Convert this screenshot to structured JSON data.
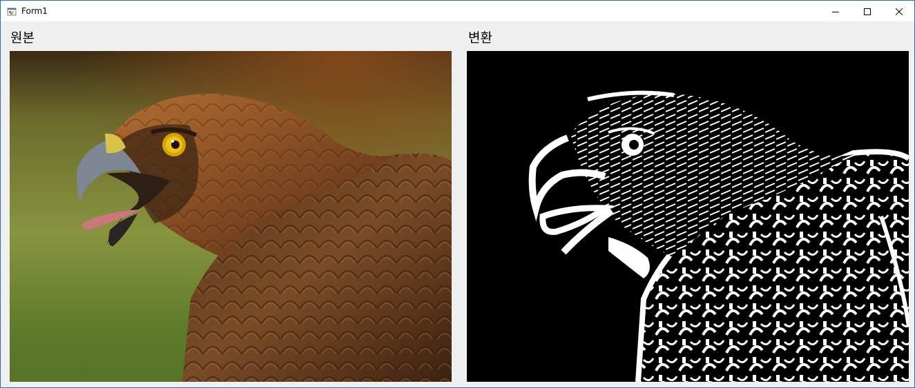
{
  "window": {
    "title": "Form1",
    "icon": "winforms-app-icon",
    "controls": {
      "minimize_icon": "minimize-icon",
      "maximize_icon": "maximize-icon",
      "close_icon": "close-icon"
    }
  },
  "panels": {
    "original": {
      "label": "원본",
      "image": "eagle-photo-original"
    },
    "converted": {
      "label": "변환",
      "image": "eagle-photo-binarized"
    }
  },
  "colors": {
    "window_border": "#2b6cb0",
    "client_background": "#f0f0f0",
    "titlebar_background": "#ffffff"
  }
}
